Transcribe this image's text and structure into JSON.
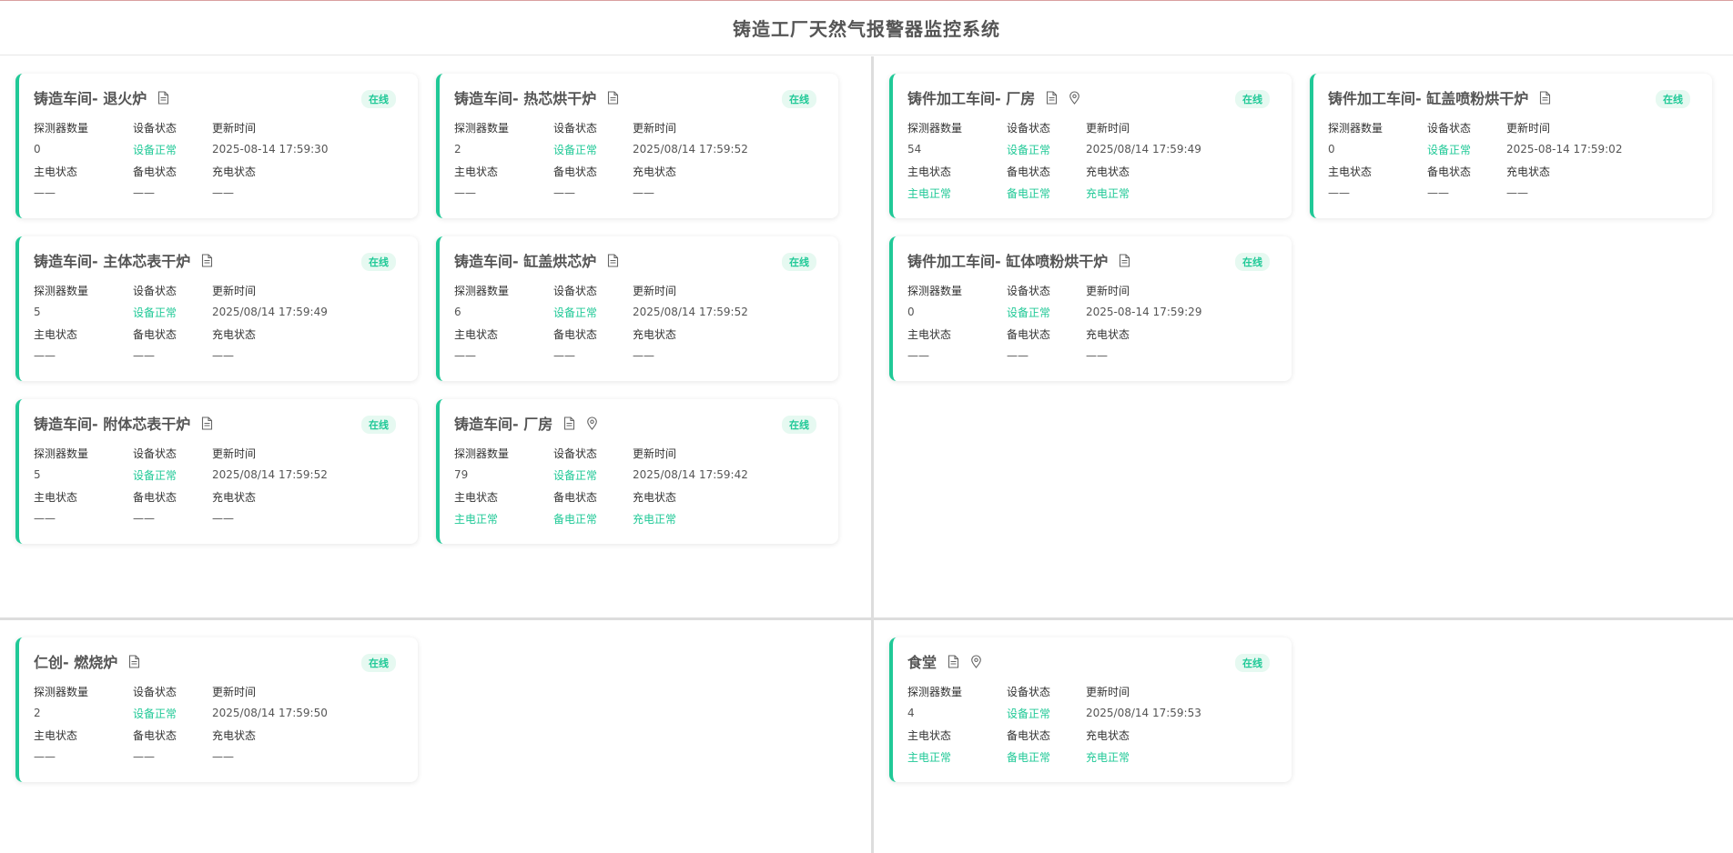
{
  "header": {
    "title": "铸造工厂天然气报警器监控系统"
  },
  "labels": {
    "detector_count": "探测器数量",
    "device_status": "设备状态",
    "update_time": "更新时间",
    "main_power": "主电状态",
    "backup_power": "备电状态",
    "charge_status": "充电状态"
  },
  "badge": "在线",
  "colors": {
    "accent": "#20c997",
    "badge_bg": "#e6f9f1"
  },
  "panels": {
    "top_left": [
      {
        "title": "铸造车间- 退火炉",
        "icons": [
          "document-icon"
        ],
        "detectors": "0",
        "device_status": "设备正常",
        "updated": "2025-08-14 17:59:30",
        "main": "——",
        "backup": "——",
        "charge": "——"
      },
      {
        "title": "铸造车间- 热芯烘干炉",
        "icons": [
          "document-icon"
        ],
        "detectors": "2",
        "device_status": "设备正常",
        "updated": "2025/08/14 17:59:52",
        "main": "——",
        "backup": "——",
        "charge": "——"
      },
      {
        "title": "铸造车间- 主体芯表干炉",
        "icons": [
          "document-icon"
        ],
        "detectors": "5",
        "device_status": "设备正常",
        "updated": "2025/08/14 17:59:49",
        "main": "——",
        "backup": "——",
        "charge": "——"
      },
      {
        "title": "铸造车间- 缸盖烘芯炉",
        "icons": [
          "document-icon"
        ],
        "detectors": "6",
        "device_status": "设备正常",
        "updated": "2025/08/14 17:59:52",
        "main": "——",
        "backup": "——",
        "charge": "——"
      },
      {
        "title": "铸造车间- 附体芯表干炉",
        "icons": [
          "document-icon"
        ],
        "detectors": "5",
        "device_status": "设备正常",
        "updated": "2025/08/14 17:59:52",
        "main": "——",
        "backup": "——",
        "charge": "——"
      },
      {
        "title": "铸造车间- 厂房",
        "icons": [
          "document-icon",
          "location-pin-icon"
        ],
        "detectors": "79",
        "device_status": "设备正常",
        "updated": "2025/08/14 17:59:42",
        "main": "主电正常",
        "backup": "备电正常",
        "charge": "充电正常"
      }
    ],
    "top_right": [
      {
        "title": "铸件加工车间- 厂房",
        "icons": [
          "document-icon",
          "location-pin-icon"
        ],
        "detectors": "54",
        "device_status": "设备正常",
        "updated": "2025/08/14 17:59:49",
        "main": "主电正常",
        "backup": "备电正常",
        "charge": "充电正常"
      },
      {
        "title": "铸件加工车间- 缸盖喷粉烘干炉",
        "icons": [
          "document-icon"
        ],
        "detectors": "0",
        "device_status": "设备正常",
        "updated": "2025-08-14 17:59:02",
        "main": "——",
        "backup": "——",
        "charge": "——"
      },
      {
        "title": "铸件加工车间- 缸体喷粉烘干炉",
        "icons": [
          "document-icon"
        ],
        "detectors": "0",
        "device_status": "设备正常",
        "updated": "2025-08-14 17:59:29",
        "main": "——",
        "backup": "——",
        "charge": "——"
      }
    ],
    "bottom_left": [
      {
        "title": "仁创- 燃烧炉",
        "icons": [
          "document-icon"
        ],
        "detectors": "2",
        "device_status": "设备正常",
        "updated": "2025/08/14 17:59:50",
        "main": "——",
        "backup": "——",
        "charge": "——"
      }
    ],
    "bottom_right": [
      {
        "title": "食堂",
        "icons": [
          "document-icon",
          "location-pin-icon"
        ],
        "detectors": "4",
        "device_status": "设备正常",
        "updated": "2025/08/14 17:59:53",
        "main": "主电正常",
        "backup": "备电正常",
        "charge": "充电正常"
      }
    ]
  }
}
